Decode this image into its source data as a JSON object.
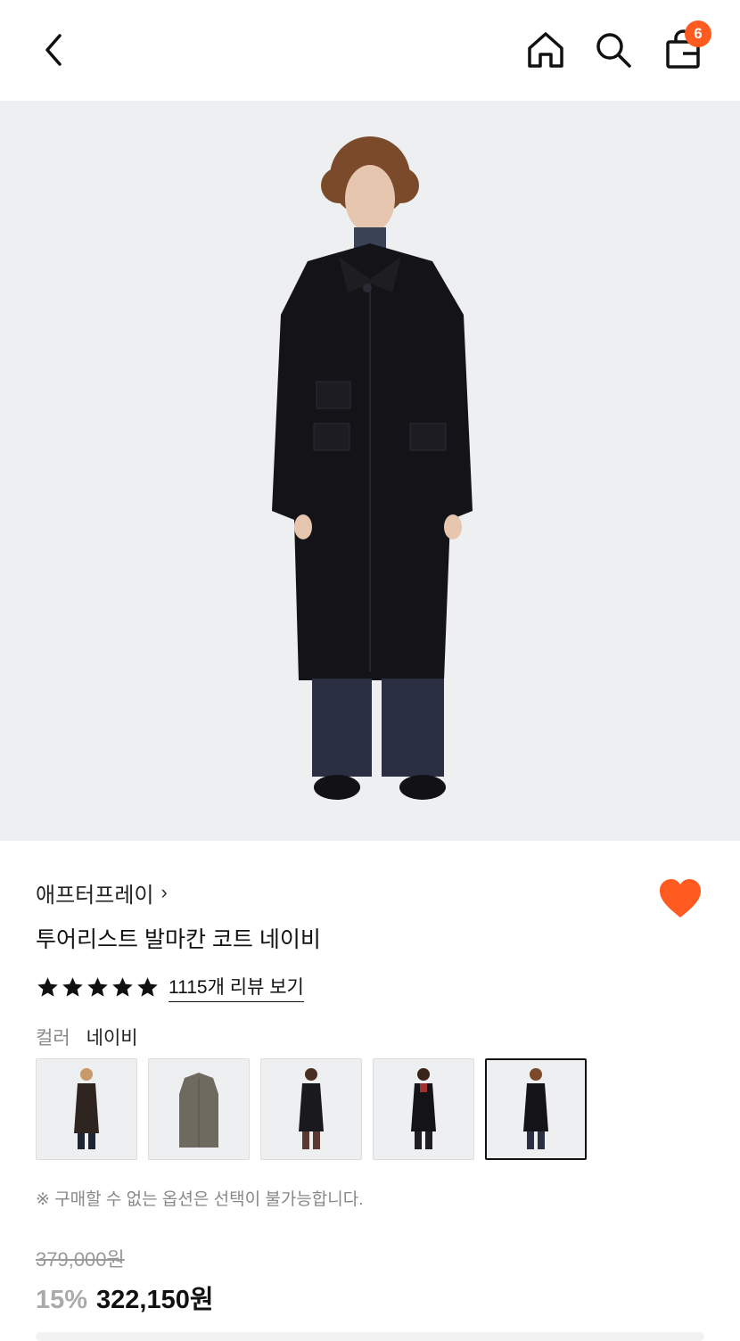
{
  "header": {
    "cart_count": "6"
  },
  "product": {
    "brand": "애프터프레이",
    "brand_chevron": "›",
    "title": "투어리스트 발마칸 코트 네이비",
    "rating_stars": 5,
    "review_link": "1115개 리뷰 보기",
    "color_label": "컬러",
    "color_value": "네이비",
    "notice": "※ 구매할 수 없는 옵션은 선택이 불가능합니다.",
    "original_price": "379,000원",
    "discount": "15%",
    "sale_price": "322,150원",
    "liked": true
  },
  "swatches": [
    {
      "name": "brown-coat-model",
      "selected": false
    },
    {
      "name": "grey-coat-flat",
      "selected": false
    },
    {
      "name": "black-coat-model-brown-pants",
      "selected": false
    },
    {
      "name": "black-coat-model-red",
      "selected": false
    },
    {
      "name": "navy-coat-model",
      "selected": true
    }
  ],
  "colors": {
    "accent": "#ff5a1f",
    "text": "#111111",
    "muted": "#888888"
  }
}
